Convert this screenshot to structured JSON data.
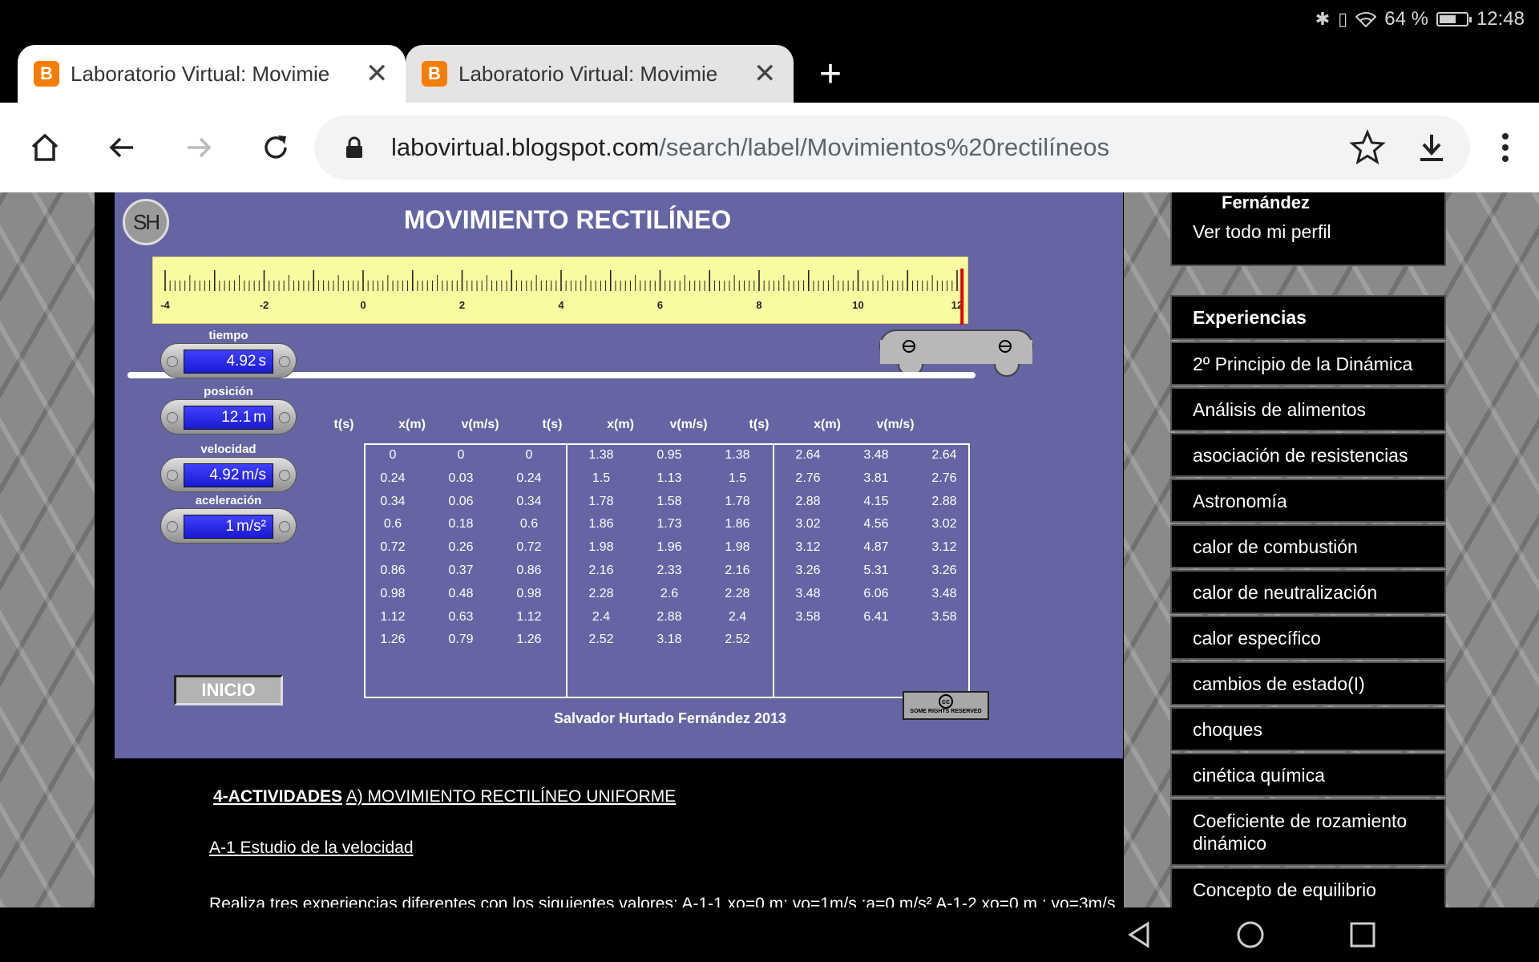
{
  "status": {
    "battery_text": "64 %",
    "time": "12:48",
    "battery_level": 0.64,
    "icons": [
      "bluetooth-icon",
      "vibrate-icon",
      "wifi-icon",
      "battery-icon"
    ]
  },
  "tabs": [
    {
      "title": "Laboratorio Virtual: Movimie",
      "active": true
    },
    {
      "title": "Laboratorio Virtual: Movimie",
      "active": false
    }
  ],
  "toolbar": {
    "url_host": "labovirtual.blogspot.com",
    "url_path": "/search/label/Movimientos%20rectilíneos"
  },
  "applet": {
    "logo": "SH",
    "title": "MOVIMIENTO RECTILÍNEO",
    "ruler_labels": [
      "-4",
      "-2",
      "0",
      "2",
      "4",
      "6",
      "8",
      "10",
      "12"
    ],
    "ruler_range": [
      -4,
      12
    ],
    "marker_position": 12.1,
    "gauges": [
      {
        "label": "tiempo",
        "value": "4.92",
        "unit": "s"
      },
      {
        "label": "posición",
        "value": "12.1",
        "unit": "m"
      },
      {
        "label": "velocidad",
        "value": "4.92",
        "unit": "m/s"
      },
      {
        "label": "aceleración",
        "value": "1",
        "unit": "m/s²"
      }
    ],
    "start_button": "INICIO",
    "column_headers": [
      "t(s)",
      "x(m)",
      "v(m/s)",
      "t(s)",
      "x(m)",
      "v(m/s)",
      "t(s)",
      "x(m)",
      "v(m/s)"
    ],
    "rows": [
      [
        "0",
        "0",
        "0",
        "1.38",
        "0.95",
        "1.38",
        "2.64",
        "3.48",
        "2.64"
      ],
      [
        "0.24",
        "0.03",
        "0.24",
        "1.5",
        "1.13",
        "1.5",
        "2.76",
        "3.81",
        "2.76"
      ],
      [
        "0.34",
        "0.06",
        "0.34",
        "1.78",
        "1.58",
        "1.78",
        "2.88",
        "4.15",
        "2.88"
      ],
      [
        "0.6",
        "0.18",
        "0.6",
        "1.86",
        "1.73",
        "1.86",
        "3.02",
        "4.56",
        "3.02"
      ],
      [
        "0.72",
        "0.26",
        "0.72",
        "1.98",
        "1.96",
        "1.98",
        "3.12",
        "4.87",
        "3.12"
      ],
      [
        "0.86",
        "0.37",
        "0.86",
        "2.16",
        "2.33",
        "2.16",
        "3.26",
        "5.31",
        "3.26"
      ],
      [
        "0.98",
        "0.48",
        "0.98",
        "2.28",
        "2.6",
        "2.28",
        "3.48",
        "6.06",
        "3.48"
      ],
      [
        "1.12",
        "0.63",
        "1.12",
        "2.4",
        "2.88",
        "2.4",
        "3.58",
        "6.41",
        "3.58"
      ],
      [
        "1.26",
        "0.79",
        "1.26",
        "2.52",
        "3.18",
        "2.52",
        "",
        "",
        ""
      ]
    ],
    "license": "SOME RIGHTS RESERVED",
    "author": "Salvador Hurtado Fernández 2013"
  },
  "article": {
    "activities_label": "4-ACTIVIDADES",
    "activities_rest": "A)  MOVIMIENTO RECTILÍNEO UNIFORME ",
    "a1_title": "A-1 Estudio de la velocidad",
    "paragraph": "Realiza tres experiencias diferentes con los siguientes valores: A-1-1  xo=0  m; vo=1m/s ;a=0 m/s² A-1-2  xo=0 m ; vo=3m/s"
  },
  "sidebar": {
    "profile_name": "Fernández",
    "profile_link": "Ver todo mi perfil",
    "section_title": "Experiencias",
    "items": [
      "2º Principio de la Dinámica",
      "Análisis de alimentos",
      "asociación de resistencias",
      "Astronomía",
      "calor de combustión",
      "calor de neutralización",
      "calor específico",
      "cambios de estado(I)",
      "choques",
      "cinética química",
      "Coeficiente de rozamiento dinámico",
      "Concepto de equilibrio"
    ]
  }
}
